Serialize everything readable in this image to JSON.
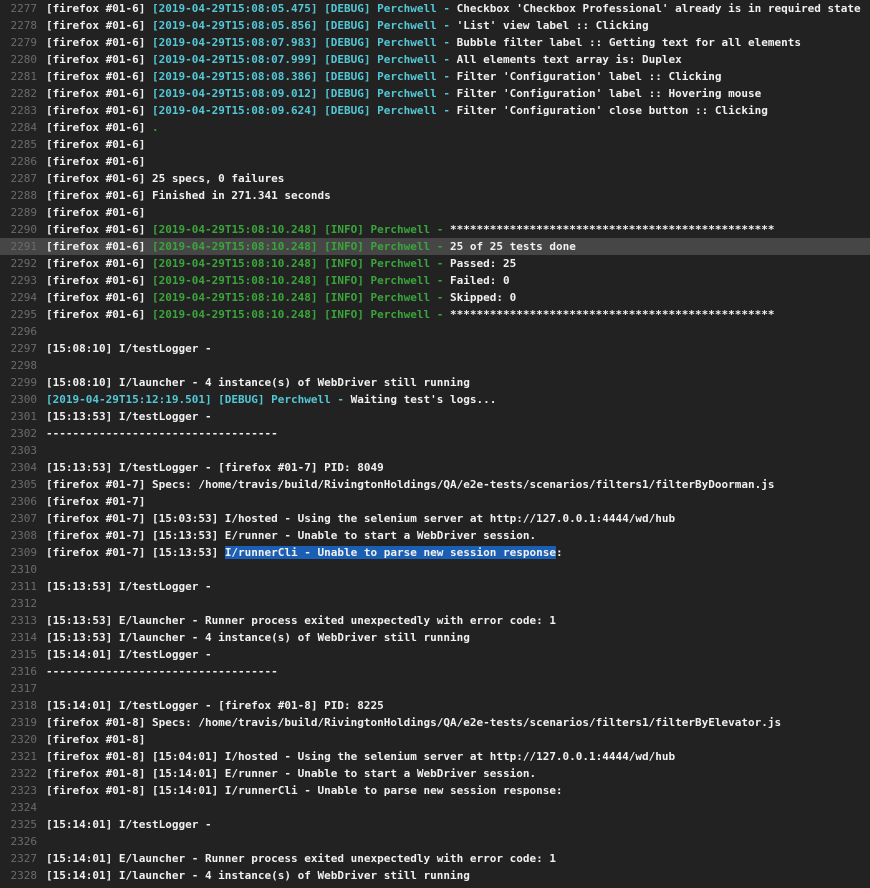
{
  "colors": {
    "background": "#222222",
    "text": "#f1f1f1",
    "line_number": "#6b6b6b",
    "cyan": "#53c8d6",
    "green": "#3aa53a",
    "selection": "#1b5fb5",
    "highlight_row": "#464646"
  },
  "lines": [
    {
      "n": "2277",
      "segs": [
        [
          "w",
          "[firefox #01-6] "
        ],
        [
          "c",
          "[2019-04-29T15:08:05.475] [DEBUG] Perchwell - "
        ],
        [
          "w",
          "Checkbox 'Checkbox Professional' already is in required state"
        ]
      ]
    },
    {
      "n": "2278",
      "segs": [
        [
          "w",
          "[firefox #01-6] "
        ],
        [
          "c",
          "[2019-04-29T15:08:05.856] [DEBUG] Perchwell - "
        ],
        [
          "w",
          "'List' view label :: Clicking"
        ]
      ]
    },
    {
      "n": "2279",
      "segs": [
        [
          "w",
          "[firefox #01-6] "
        ],
        [
          "c",
          "[2019-04-29T15:08:07.983] [DEBUG] Perchwell - "
        ],
        [
          "w",
          "Bubble filter label :: Getting text for all elements"
        ]
      ]
    },
    {
      "n": "2280",
      "segs": [
        [
          "w",
          "[firefox #01-6] "
        ],
        [
          "c",
          "[2019-04-29T15:08:07.999] [DEBUG] Perchwell - "
        ],
        [
          "w",
          "All elements text array is: Duplex"
        ]
      ]
    },
    {
      "n": "2281",
      "segs": [
        [
          "w",
          "[firefox #01-6] "
        ],
        [
          "c",
          "[2019-04-29T15:08:08.386] [DEBUG] Perchwell - "
        ],
        [
          "w",
          "Filter 'Configuration' label :: Clicking"
        ]
      ]
    },
    {
      "n": "2282",
      "segs": [
        [
          "w",
          "[firefox #01-6] "
        ],
        [
          "c",
          "[2019-04-29T15:08:09.012] [DEBUG] Perchwell - "
        ],
        [
          "w",
          "Filter 'Configuration' label :: Hovering mouse"
        ]
      ]
    },
    {
      "n": "2283",
      "segs": [
        [
          "w",
          "[firefox #01-6] "
        ],
        [
          "c",
          "[2019-04-29T15:08:09.624] [DEBUG] Perchwell - "
        ],
        [
          "w",
          "Filter 'Configuration' close button :: Clicking"
        ]
      ]
    },
    {
      "n": "2284",
      "segs": [
        [
          "w",
          "[firefox #01-6] "
        ],
        [
          "g",
          "."
        ]
      ]
    },
    {
      "n": "2285",
      "segs": [
        [
          "w",
          "[firefox #01-6]"
        ]
      ]
    },
    {
      "n": "2286",
      "segs": [
        [
          "w",
          "[firefox #01-6]"
        ]
      ]
    },
    {
      "n": "2287",
      "segs": [
        [
          "w",
          "[firefox #01-6] 25 specs, 0 failures"
        ]
      ]
    },
    {
      "n": "2288",
      "segs": [
        [
          "w",
          "[firefox #01-6] Finished in 271.341 seconds"
        ]
      ]
    },
    {
      "n": "2289",
      "segs": [
        [
          "w",
          "[firefox #01-6]"
        ]
      ]
    },
    {
      "n": "2290",
      "segs": [
        [
          "w",
          "[firefox #01-6] "
        ],
        [
          "g",
          "[2019-04-29T15:08:10.248] [INFO] Perchwell - "
        ],
        [
          "w",
          "*************************************************"
        ]
      ]
    },
    {
      "n": "2291",
      "hl": true,
      "segs": [
        [
          "w",
          "[firefox #01-6] "
        ],
        [
          "g",
          "[2019-04-29T15:08:10.248] [INFO] Perchwell - "
        ],
        [
          "w",
          "25 of 25 tests done"
        ]
      ]
    },
    {
      "n": "2292",
      "segs": [
        [
          "w",
          "[firefox #01-6] "
        ],
        [
          "g",
          "[2019-04-29T15:08:10.248] [INFO] Perchwell - "
        ],
        [
          "w",
          "Passed: 25"
        ]
      ]
    },
    {
      "n": "2293",
      "segs": [
        [
          "w",
          "[firefox #01-6] "
        ],
        [
          "g",
          "[2019-04-29T15:08:10.248] [INFO] Perchwell - "
        ],
        [
          "w",
          "Failed: 0"
        ]
      ]
    },
    {
      "n": "2294",
      "segs": [
        [
          "w",
          "[firefox #01-6] "
        ],
        [
          "g",
          "[2019-04-29T15:08:10.248] [INFO] Perchwell - "
        ],
        [
          "w",
          "Skipped: 0"
        ]
      ]
    },
    {
      "n": "2295",
      "segs": [
        [
          "w",
          "[firefox #01-6] "
        ],
        [
          "g",
          "[2019-04-29T15:08:10.248] [INFO] Perchwell - "
        ],
        [
          "w",
          "*************************************************"
        ]
      ]
    },
    {
      "n": "2296",
      "segs": []
    },
    {
      "n": "2297",
      "segs": [
        [
          "w",
          "[15:08:10] I/testLogger -"
        ]
      ]
    },
    {
      "n": "2298",
      "segs": []
    },
    {
      "n": "2299",
      "segs": [
        [
          "w",
          "[15:08:10] I/launcher - 4 instance(s) of WebDriver still running"
        ]
      ]
    },
    {
      "n": "2300",
      "segs": [
        [
          "c",
          "[2019-04-29T15:12:19.501] [DEBUG] Perchwell - "
        ],
        [
          "w",
          "Waiting test's logs..."
        ]
      ]
    },
    {
      "n": "2301",
      "segs": [
        [
          "w",
          "[15:13:53] I/testLogger -"
        ]
      ]
    },
    {
      "n": "2302",
      "segs": [
        [
          "w",
          "-----------------------------------"
        ]
      ]
    },
    {
      "n": "2303",
      "segs": []
    },
    {
      "n": "2304",
      "segs": [
        [
          "w",
          "[15:13:53] I/testLogger - [firefox #01-7] PID: 8049"
        ]
      ]
    },
    {
      "n": "2305",
      "segs": [
        [
          "w",
          "[firefox #01-7] Specs: /home/travis/build/RivingtonHoldings/QA/e2e-tests/scenarios/filters1/filterByDoorman.js"
        ]
      ]
    },
    {
      "n": "2306",
      "segs": [
        [
          "w",
          "[firefox #01-7]"
        ]
      ]
    },
    {
      "n": "2307",
      "segs": [
        [
          "w",
          "[firefox #01-7] [15:03:53] I/hosted - Using the selenium server at http://127.0.0.1:4444/wd/hub"
        ]
      ]
    },
    {
      "n": "2308",
      "segs": [
        [
          "w",
          "[firefox #01-7] [15:13:53] E/runner - Unable to start a WebDriver session."
        ]
      ]
    },
    {
      "n": "2309",
      "segs": [
        [
          "w",
          "[firefox #01-7] [15:13:53] "
        ],
        [
          "sel",
          "I/runnerCli - Unable to parse new session response"
        ],
        [
          "w",
          ":"
        ]
      ]
    },
    {
      "n": "2310",
      "segs": []
    },
    {
      "n": "2311",
      "segs": [
        [
          "w",
          "[15:13:53] I/testLogger -"
        ]
      ]
    },
    {
      "n": "2312",
      "segs": []
    },
    {
      "n": "2313",
      "segs": [
        [
          "w",
          "[15:13:53] E/launcher - Runner process exited unexpectedly with error code: 1"
        ]
      ]
    },
    {
      "n": "2314",
      "segs": [
        [
          "w",
          "[15:13:53] I/launcher - 4 instance(s) of WebDriver still running"
        ]
      ]
    },
    {
      "n": "2315",
      "segs": [
        [
          "w",
          "[15:14:01] I/testLogger -"
        ]
      ]
    },
    {
      "n": "2316",
      "segs": [
        [
          "w",
          "-----------------------------------"
        ]
      ]
    },
    {
      "n": "2317",
      "segs": []
    },
    {
      "n": "2318",
      "segs": [
        [
          "w",
          "[15:14:01] I/testLogger - [firefox #01-8] PID: 8225"
        ]
      ]
    },
    {
      "n": "2319",
      "segs": [
        [
          "w",
          "[firefox #01-8] Specs: /home/travis/build/RivingtonHoldings/QA/e2e-tests/scenarios/filters1/filterByElevator.js"
        ]
      ]
    },
    {
      "n": "2320",
      "segs": [
        [
          "w",
          "[firefox #01-8]"
        ]
      ]
    },
    {
      "n": "2321",
      "segs": [
        [
          "w",
          "[firefox #01-8] [15:04:01] I/hosted - Using the selenium server at http://127.0.0.1:4444/wd/hub"
        ]
      ]
    },
    {
      "n": "2322",
      "segs": [
        [
          "w",
          "[firefox #01-8] [15:14:01] E/runner - Unable to start a WebDriver session."
        ]
      ]
    },
    {
      "n": "2323",
      "segs": [
        [
          "w",
          "[firefox #01-8] [15:14:01] I/runnerCli - Unable to parse new session response:"
        ]
      ]
    },
    {
      "n": "2324",
      "segs": []
    },
    {
      "n": "2325",
      "segs": [
        [
          "w",
          "[15:14:01] I/testLogger -"
        ]
      ]
    },
    {
      "n": "2326",
      "segs": []
    },
    {
      "n": "2327",
      "segs": [
        [
          "w",
          "[15:14:01] E/launcher - Runner process exited unexpectedly with error code: 1"
        ]
      ]
    },
    {
      "n": "2328",
      "segs": [
        [
          "w",
          "[15:14:01] I/launcher - 4 instance(s) of WebDriver still running"
        ]
      ]
    }
  ]
}
